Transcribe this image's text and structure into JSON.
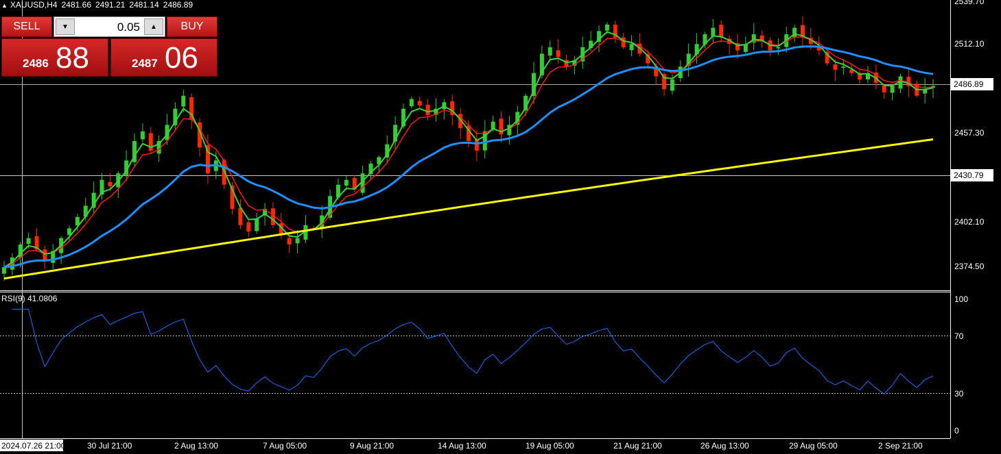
{
  "header": {
    "symbol": "XAUUSD,H4",
    "open": "2481.66",
    "high": "2491.21",
    "low": "2481.14",
    "close": "2486.89"
  },
  "trade_panel": {
    "sell_label": "SELL",
    "buy_label": "BUY",
    "lot_size": "0.05",
    "sell_price_small": "2486",
    "sell_price_big": "88",
    "buy_price_small": "2487",
    "buy_price_big": "06"
  },
  "price_axis": {
    "ticks": [
      "2539.70",
      "2512.10",
      "2457.30",
      "2402.10",
      "2374.50"
    ],
    "current_price": "2486.89",
    "crosshair_price": "2430.79"
  },
  "rsi": {
    "label": "RSI(9) 41.0806",
    "ticks": [
      "100",
      "70",
      "30",
      "0"
    ]
  },
  "time_axis": {
    "crosshair_time": "2024.07.26 21:00",
    "ticks": [
      "30 Jul 21:00",
      "2 Aug 13:00",
      "7 Aug 05:00",
      "9 Aug 21:00",
      "14 Aug 13:00",
      "19 Aug 05:00",
      "21 Aug 21:00",
      "26 Aug 13:00",
      "29 Aug 05:00",
      "2 Sep 21:00"
    ]
  },
  "colors": {
    "bull": "#32cd32",
    "bear": "#ff2a00",
    "ma_fast": "#ff1a1a",
    "ma_mid": "#3cd23c",
    "ma_slow": "#1e90ff",
    "ma_long": "#ffff00",
    "rsi_line": "#1e6fff"
  },
  "chart_data": {
    "type": "candlestick",
    "timeframe": "H4",
    "ylim": [
      2362,
      2542
    ],
    "close": [
      2374,
      2380,
      2388,
      2392,
      2385,
      2378,
      2384,
      2392,
      2398,
      2405,
      2412,
      2420,
      2428,
      2424,
      2432,
      2440,
      2452,
      2458,
      2446,
      2452,
      2462,
      2472,
      2480,
      2465,
      2448,
      2432,
      2440,
      2425,
      2410,
      2400,
      2396,
      2404,
      2410,
      2400,
      2394,
      2388,
      2392,
      2400,
      2398,
      2406,
      2418,
      2425,
      2428,
      2422,
      2432,
      2438,
      2442,
      2450,
      2462,
      2472,
      2478,
      2474,
      2468,
      2472,
      2476,
      2468,
      2460,
      2452,
      2446,
      2458,
      2464,
      2456,
      2462,
      2470,
      2480,
      2494,
      2506,
      2510,
      2504,
      2498,
      2502,
      2510,
      2514,
      2520,
      2524,
      2516,
      2510,
      2512,
      2506,
      2500,
      2492,
      2484,
      2490,
      2498,
      2506,
      2512,
      2518,
      2522,
      2516,
      2512,
      2508,
      2512,
      2518,
      2514,
      2508,
      2510,
      2518,
      2522,
      2516,
      2512,
      2508,
      2500,
      2496,
      2498,
      2494,
      2490,
      2494,
      2488,
      2482,
      2486,
      2492,
      2486,
      2480,
      2484,
      2486
    ]
  }
}
